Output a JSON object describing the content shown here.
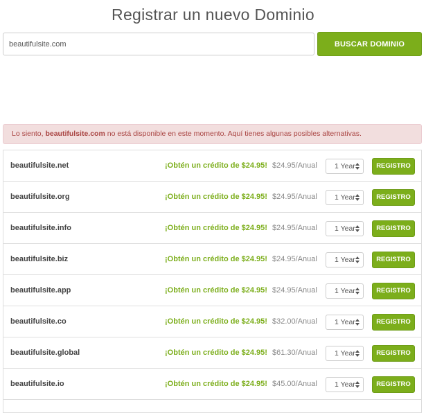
{
  "header": {
    "title": "Registrar un nuevo Dominio"
  },
  "search": {
    "value": "beautifulsite.com",
    "placeholder": "",
    "button_label": "BUSCAR DOMINIO"
  },
  "alert": {
    "prefix": "Lo siento, ",
    "domain": "beautifulsite.com",
    "suffix": " no está disponible en este momento. Aquí tienes algunas posibles alternativas.",
    "color": "#a94442",
    "background": "#f2dede"
  },
  "colors": {
    "accent": "#7cae1b"
  },
  "results": [
    {
      "domain": "beautifulsite.net",
      "promo": "¡Obtén un crédito de $24.95!",
      "price": "$24.95/Anual",
      "period": "1 Year",
      "button": "REGISTRO"
    },
    {
      "domain": "beautifulsite.org",
      "promo": "¡Obtén un crédito de $24.95!",
      "price": "$24.95/Anual",
      "period": "1 Year",
      "button": "REGISTRO"
    },
    {
      "domain": "beautifulsite.info",
      "promo": "¡Obtén un crédito de $24.95!",
      "price": "$24.95/Anual",
      "period": "1 Year",
      "button": "REGISTRO"
    },
    {
      "domain": "beautifulsite.biz",
      "promo": "¡Obtén un crédito de $24.95!",
      "price": "$24.95/Anual",
      "period": "1 Year",
      "button": "REGISTRO"
    },
    {
      "domain": "beautifulsite.app",
      "promo": "¡Obtén un crédito de $24.95!",
      "price": "$24.95/Anual",
      "period": "1 Year",
      "button": "REGISTRO"
    },
    {
      "domain": "beautifulsite.co",
      "promo": "¡Obtén un crédito de $24.95!",
      "price": "$32.00/Anual",
      "period": "1 Year",
      "button": "REGISTRO"
    },
    {
      "domain": "beautifulsite.global",
      "promo": "¡Obtén un crédito de $24.95!",
      "price": "$61.30/Anual",
      "period": "1 Year",
      "button": "REGISTRO"
    },
    {
      "domain": "beautifulsite.io",
      "promo": "¡Obtén un crédito de $24.95!",
      "price": "$45.00/Anual",
      "period": "1 Year",
      "button": "REGISTRO"
    }
  ]
}
